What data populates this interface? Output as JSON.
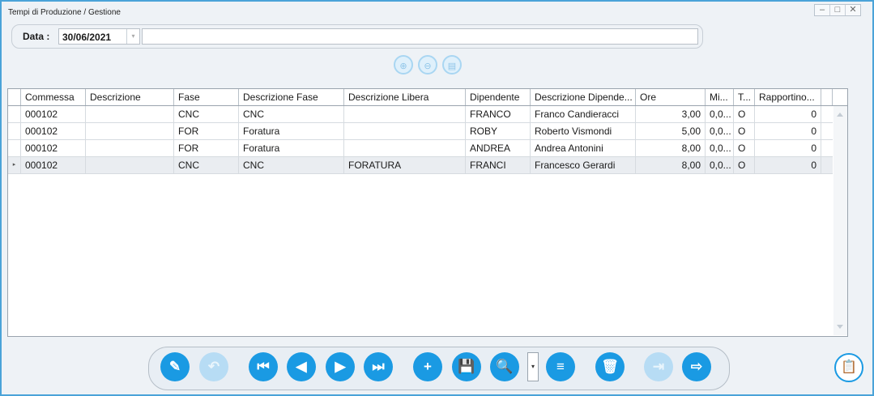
{
  "window": {
    "title": "Tempi di Produzione / Gestione",
    "controls": [
      "–",
      "□",
      "✕"
    ]
  },
  "filter": {
    "date_label": "Data :",
    "date_value": "30/06/2021",
    "dropdown_icon": "▾",
    "description_value": ""
  },
  "mini_toolbar": [
    "add-row-icon",
    "remove-row-icon",
    "clipboard-icon"
  ],
  "grid": {
    "columns": [
      "Commessa",
      "Descrizione",
      "Fase",
      "Descrizione Fase",
      "Descrizione Libera",
      "Dipendente",
      "Descrizione Dipende...",
      "Ore",
      "Mi...",
      "T...",
      "Rapportino..."
    ],
    "rows": [
      [
        "000102",
        "",
        "CNC",
        "CNC",
        "",
        "FRANCO",
        "Franco Candieracci",
        "3,00",
        "0,0...",
        "O",
        "0"
      ],
      [
        "000102",
        "",
        "FOR",
        "Foratura",
        "",
        "ROBY",
        "Roberto Vismondi",
        "5,00",
        "0,0...",
        "O",
        "0"
      ],
      [
        "000102",
        "",
        "FOR",
        "Foratura",
        "",
        "ANDREA",
        "Andrea Antonini",
        "8,00",
        "0,0...",
        "O",
        "0"
      ],
      [
        "000102",
        "",
        "CNC",
        "CNC",
        "FORATURA",
        "FRANCI",
        "Francesco Gerardi",
        "8,00",
        "0,0...",
        "O",
        "0"
      ]
    ],
    "selected_row_marker": "▸"
  },
  "toolbar": {
    "edit": "✎",
    "undo": "↶",
    "first": "⏮",
    "prev": "◀",
    "next": "▶",
    "last": "⏭",
    "new": "+",
    "save": "💾",
    "search": "🔍",
    "search_dd": "▾",
    "list": "≡",
    "delete": "🗑",
    "export": "⇥",
    "exit": "⇨"
  },
  "clipboard_button": "📋",
  "colors": {
    "accent": "#1a9ae3",
    "window_border": "#4aa3d8",
    "disabled": "#b7dcf4"
  }
}
